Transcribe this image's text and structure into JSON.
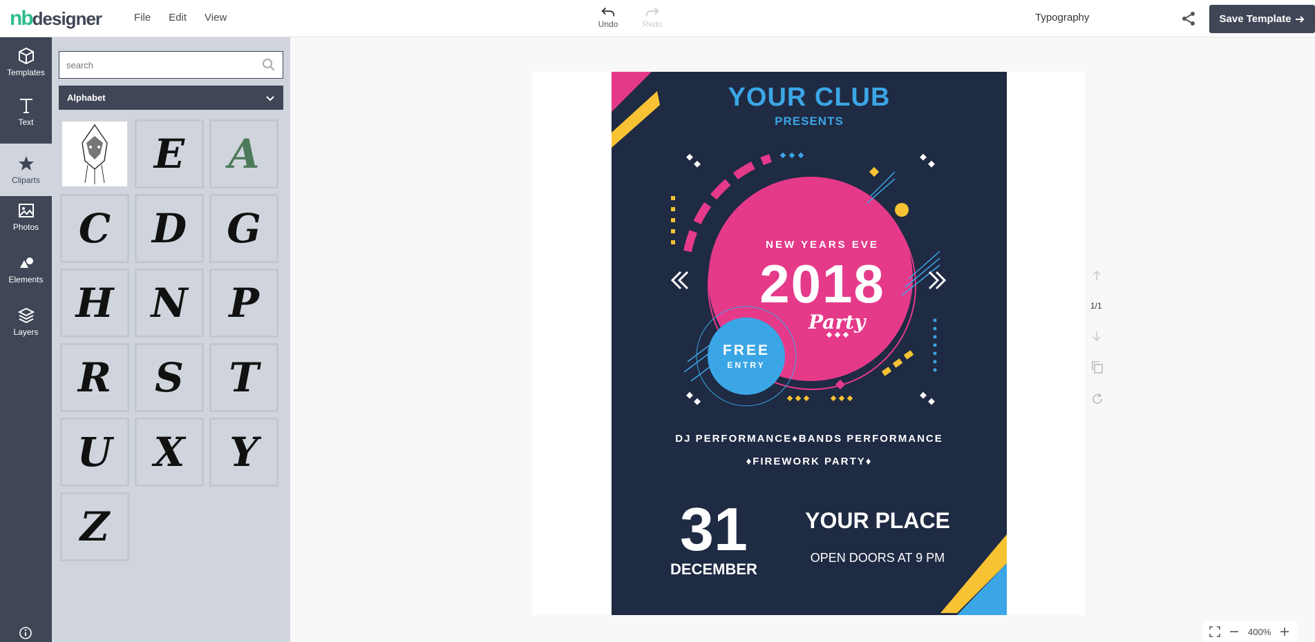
{
  "app": {
    "logo_nb": "nb",
    "logo_designer": "designer"
  },
  "menu": {
    "file": "File",
    "edit": "Edit",
    "view": "View"
  },
  "toolbar": {
    "undo": "Undo",
    "redo": "Redo",
    "typography": "Typography",
    "save_label": "Save Template"
  },
  "sidebar": {
    "items": [
      {
        "label": "Templates",
        "icon": "box-icon"
      },
      {
        "label": "Text",
        "icon": "text-icon"
      },
      {
        "label": "Cliparts",
        "icon": "star-icon"
      },
      {
        "label": "Photos",
        "icon": "image-icon"
      },
      {
        "label": "Elements",
        "icon": "shapes-icon"
      },
      {
        "label": "Layers",
        "icon": "layers-icon"
      }
    ]
  },
  "panel": {
    "search_placeholder": "search",
    "category": "Alphabet",
    "cliparts": [
      "",
      "E",
      "A",
      "C",
      "D",
      "G",
      "H",
      "N",
      "P",
      "R",
      "S",
      "T",
      "U",
      "X",
      "Y",
      "Z"
    ]
  },
  "pagination": {
    "current": "1/1"
  },
  "zoom": {
    "level": "400%"
  },
  "poster": {
    "club": "YOUR CLUB",
    "presents": "PRESENTS",
    "nye": "NEW YEARS EVE",
    "year": "2018",
    "party": "Party",
    "free": "FREE",
    "entry": "ENTRY",
    "line1": "DJ PERFORMANCE♦BANDS PERFORMANCE",
    "line2": "♦FIREWORK PARTY♦",
    "day": "31",
    "month": "DECEMBER",
    "place": "YOUR PLACE",
    "doors": "OPEN DOORS AT 9 PM"
  },
  "colors": {
    "sidebar": "#3f4656",
    "panel": "#d0d5dd",
    "brand_green": "#2dbc8e",
    "poster_bg": "#1f2a43",
    "pink": "#e53a8a",
    "blue": "#3ba6e6",
    "yellow": "#f7c233"
  }
}
